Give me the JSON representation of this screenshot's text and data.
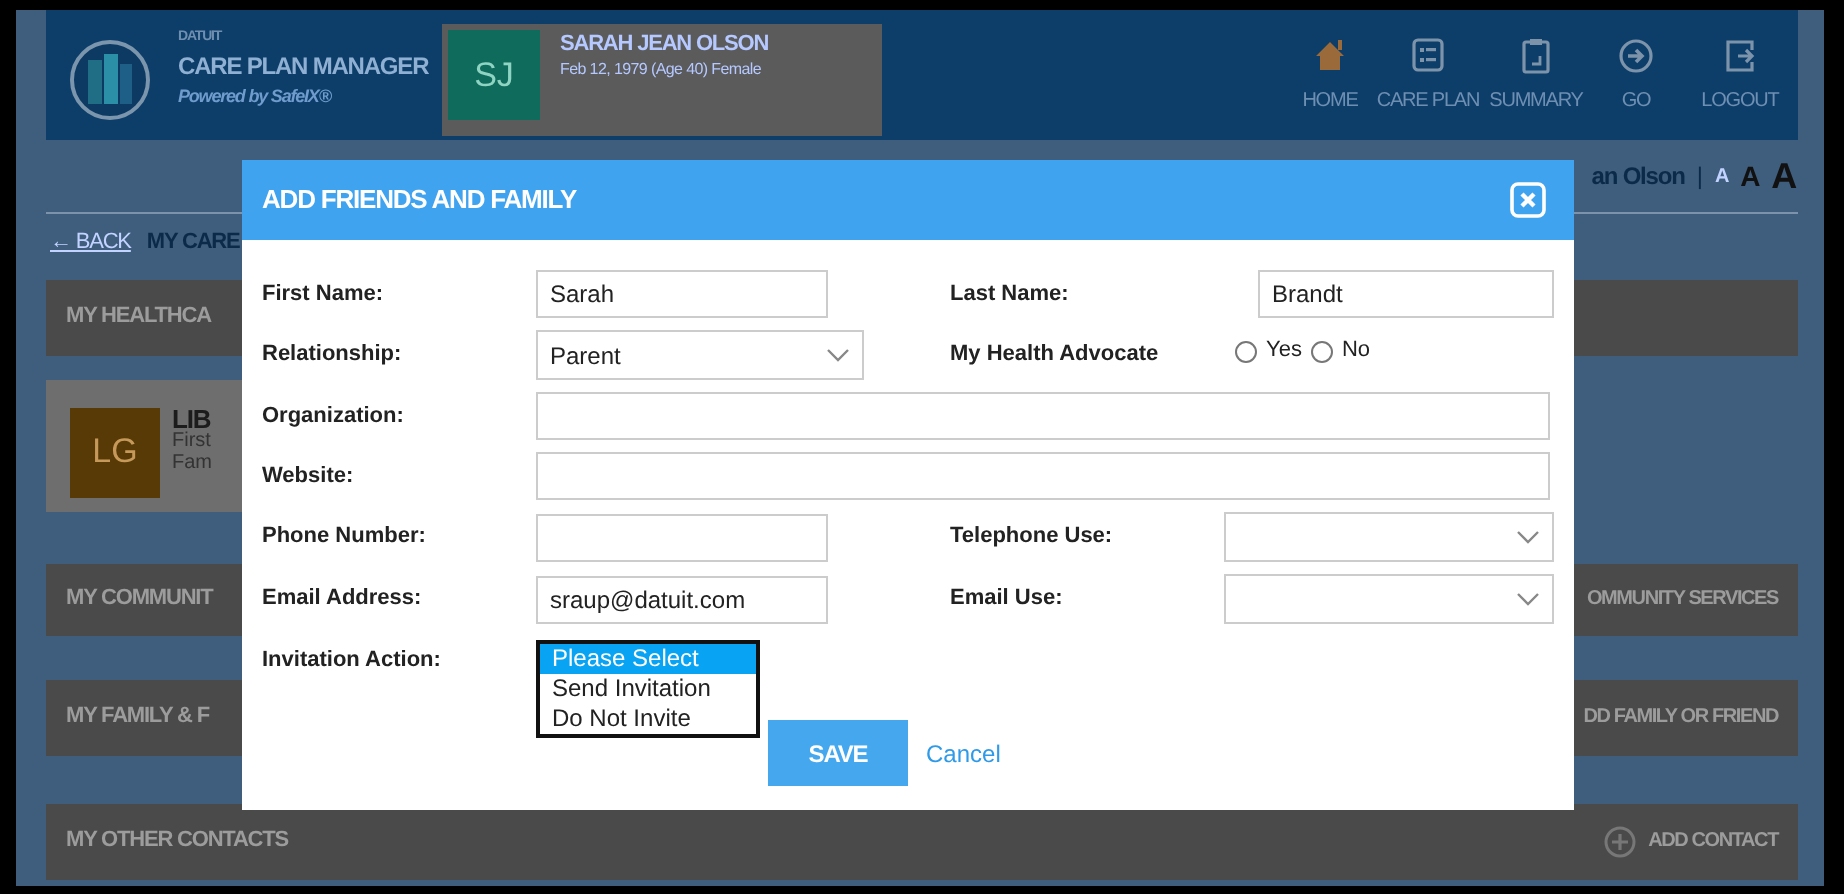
{
  "header": {
    "brand": "DATUIT",
    "app_title": "CARE PLAN MANAGER",
    "tagline": "Powered by SafeIX®",
    "patient": {
      "initials": "SJ",
      "name": "SARAH JEAN OLSON",
      "details": "Feb 12, 1979 (Age 40) Female"
    },
    "nav": [
      {
        "label": "HOME",
        "selected": true
      },
      {
        "label": "CARE PLAN",
        "selected": false
      },
      {
        "label": "SUMMARY",
        "selected": false
      },
      {
        "label": "GO",
        "selected": false
      },
      {
        "label": "LOGOUT",
        "selected": false
      }
    ]
  },
  "user_bar": {
    "user_name": "an Olson",
    "separator": "|",
    "font_sizes": [
      "A",
      "A",
      "A"
    ]
  },
  "breadcrumb": {
    "back": "← BACK",
    "current": "MY CARE"
  },
  "sections": [
    {
      "title": "MY HEALTHCA",
      "contacts": [
        {
          "initials": "LG",
          "name": "LIB",
          "lines": [
            "First",
            "Fam"
          ]
        }
      ]
    },
    {
      "title": "MY COMMUNIT",
      "action": "OMMUNITY SERVICES",
      "action_icon": false
    },
    {
      "title": "MY FAMILY & F",
      "action": "DD FAMILY OR FRIEND",
      "action_icon": false
    },
    {
      "title": "MY OTHER CONTACTS",
      "action": "ADD CONTACT",
      "action_icon": true
    }
  ],
  "modal": {
    "title": "ADD FRIENDS AND FAMILY",
    "rows": [
      [
        {
          "label": "First Name:",
          "kind": "text",
          "value": "Sarah"
        },
        {
          "label": "Last Name:",
          "kind": "text",
          "value": "Brandt"
        }
      ],
      [
        {
          "label": "Relationship:",
          "kind": "select",
          "value": "Parent"
        },
        {
          "label": "My Health Advocate",
          "kind": "radio",
          "options": [
            {
              "label": "Yes",
              "selected": false
            },
            {
              "label": "No",
              "selected": false
            }
          ]
        }
      ],
      [
        {
          "label": "Organization:",
          "kind": "wide"
        }
      ],
      [
        {
          "label": "Website:",
          "kind": "wide"
        }
      ],
      [
        {
          "label": "Phone Number:",
          "kind": "text"
        },
        {
          "label": "Telephone Use:",
          "kind": "select"
        }
      ],
      [
        {
          "label": "Email Address:",
          "kind": "text",
          "value": "sraup@datuit.com"
        },
        {
          "label": "Email Use:",
          "kind": "select"
        }
      ],
      [
        {
          "label": "Invitation Action:",
          "kind": "listbox",
          "options": [
            {
              "label": "Please Select",
              "selected": true
            },
            {
              "label": "Send Invitation",
              "selected": false
            },
            {
              "label": "Do Not Invite",
              "selected": false
            }
          ]
        }
      ]
    ],
    "save": "SAVE",
    "cancel": "Cancel"
  }
}
